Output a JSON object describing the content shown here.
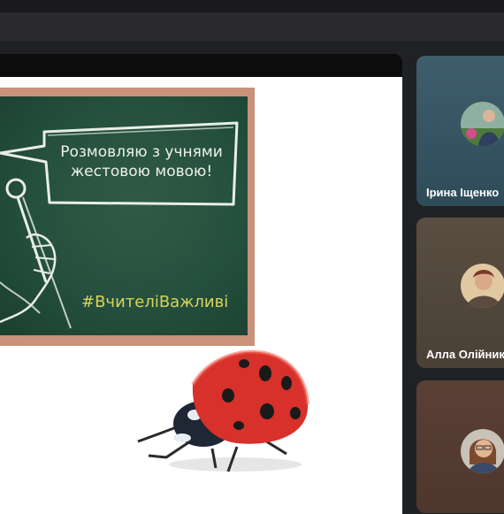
{
  "slide": {
    "speech_line1": "Розмовляю з учнями",
    "speech_line2": "жестовою мовою!",
    "hashtag": "#ВчителіВажливі"
  },
  "participants": [
    {
      "name": "Ірина Іщенко",
      "avatar_color": "#6f8f9c"
    },
    {
      "name": "Алла Олійник",
      "avatar_color": "#c9a57a"
    },
    {
      "name": "",
      "avatar_color": "#b07a63"
    }
  ],
  "colors": {
    "background": "#202124",
    "chalkboard": "#24503d",
    "hashtag": "#d8d35a",
    "ladybug_red": "#d8302a"
  }
}
